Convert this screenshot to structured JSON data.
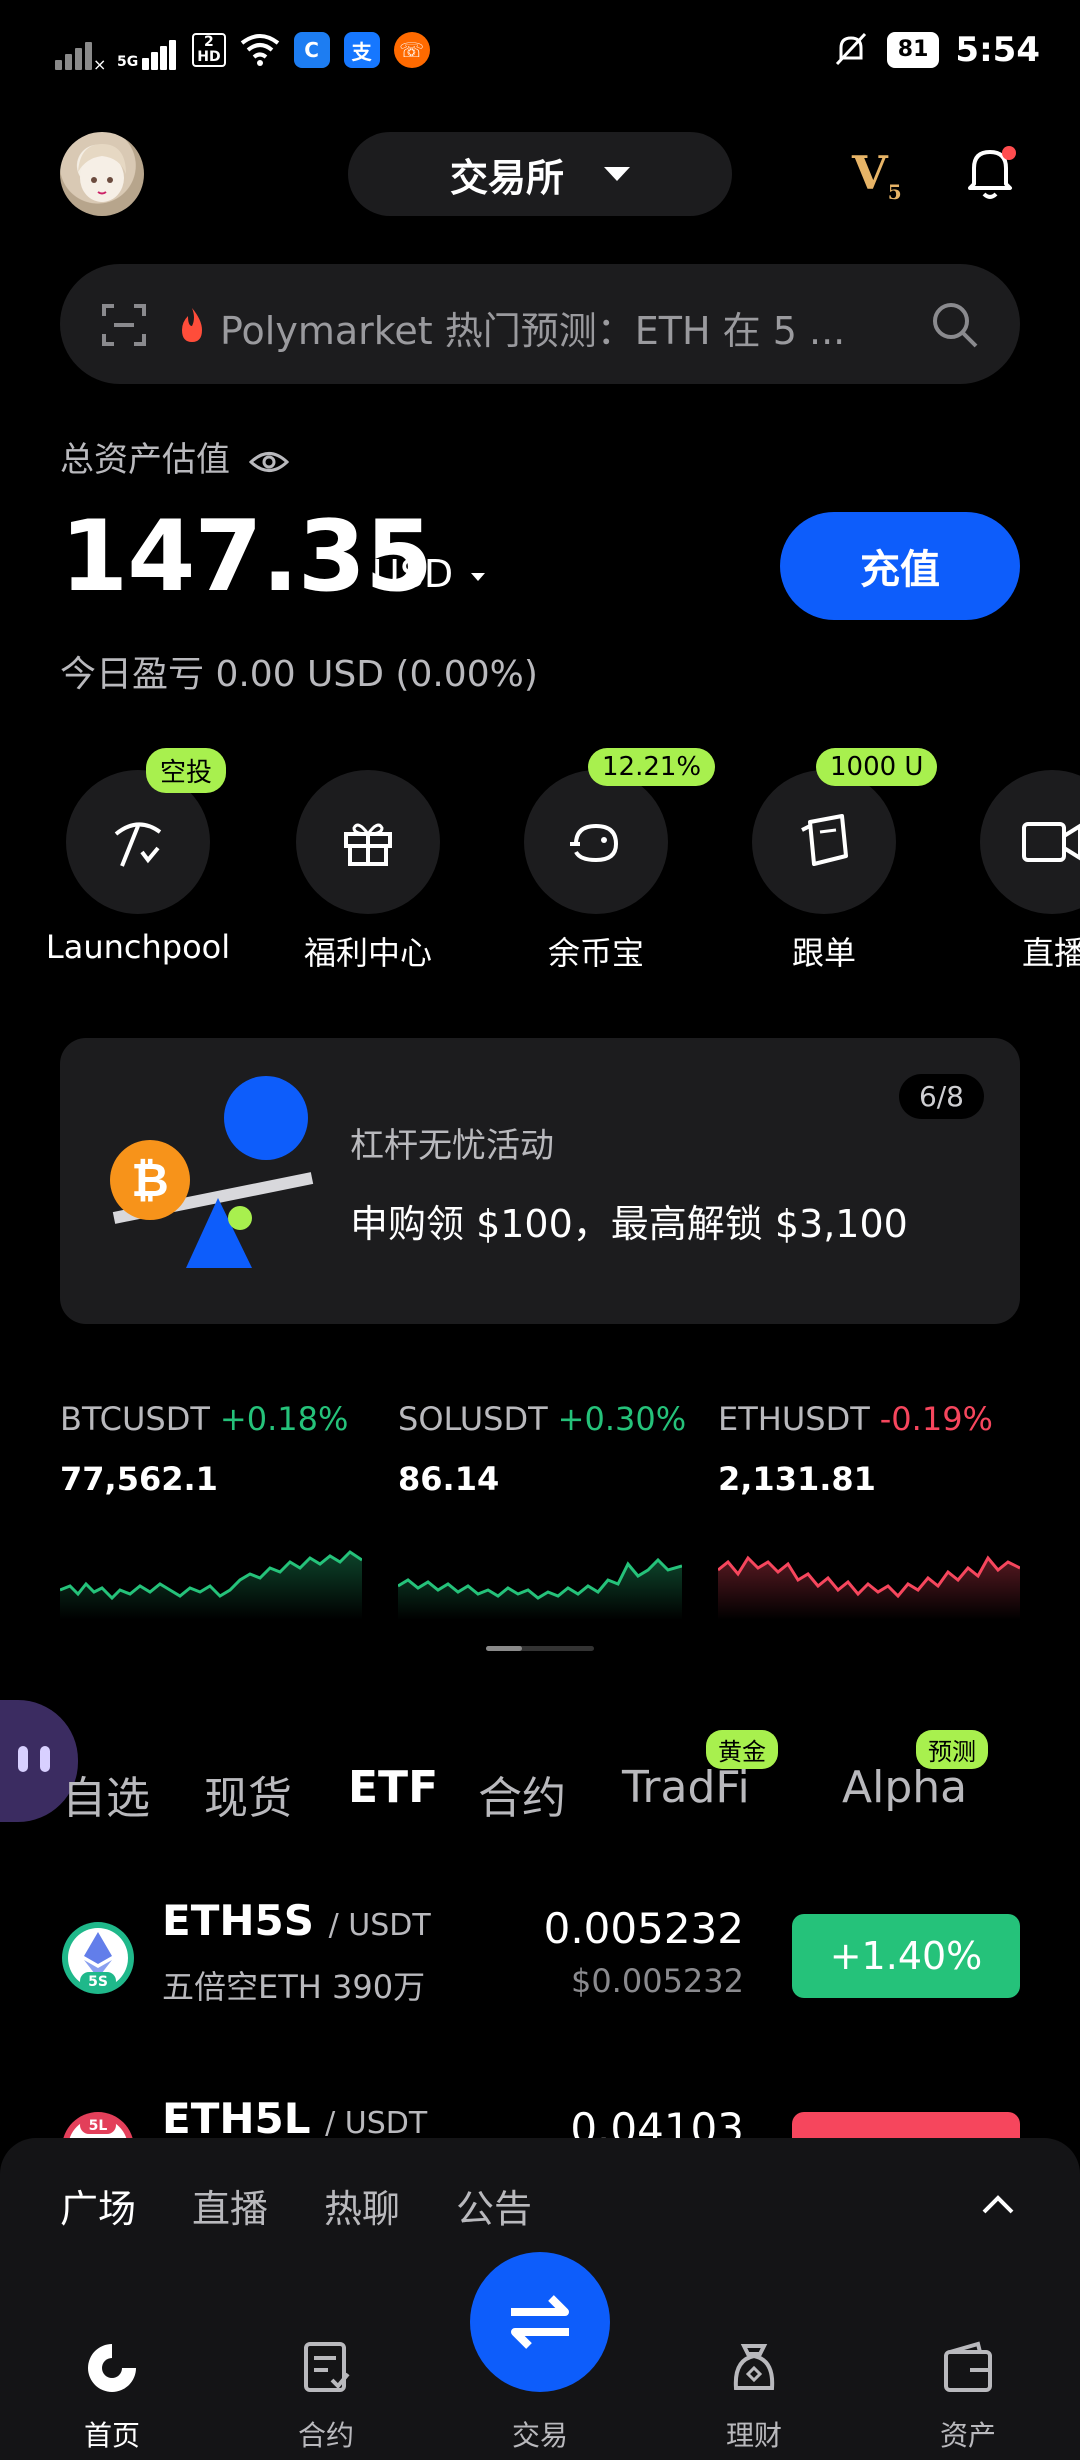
{
  "status_bar": {
    "network_5g": "5G",
    "hd_label": "2\nHD",
    "wifi_label": "6",
    "battery": "81",
    "time": "5:54"
  },
  "header": {
    "exchange_label": "交易所",
    "vip_label": "V",
    "vip_level": "5"
  },
  "search": {
    "placeholder": "Polymarket 热门预测：ETH 在 5 ..."
  },
  "assets": {
    "label": "总资产估值",
    "total": "147.35",
    "currency": "USD",
    "recharge_label": "充值",
    "pnl": "今日盈亏 0.00 USD (0.00%)"
  },
  "shortcuts": [
    {
      "name": "Launchpool",
      "badge": "空投"
    },
    {
      "name": "福利中心",
      "badge": ""
    },
    {
      "name": "余币宝",
      "badge": "12.21%"
    },
    {
      "name": "跟单",
      "badge": "1000 U"
    },
    {
      "name": "直播",
      "badge": ""
    }
  ],
  "banner": {
    "counter": "6/8",
    "subtitle": "杠杆无忧活动",
    "title": "申购领 $100，最高解锁 $3,100"
  },
  "tickers": [
    {
      "symbol": "BTCUSDT",
      "change": "+0.18%",
      "price": "77,562.1",
      "direction": "up"
    },
    {
      "symbol": "SOLUSDT",
      "change": "+0.30%",
      "price": "86.14",
      "direction": "up"
    },
    {
      "symbol": "ETHUSDT",
      "change": "-0.19%",
      "price": "2,131.81",
      "direction": "down"
    }
  ],
  "market_tabs": [
    {
      "label": "自选",
      "badge": ""
    },
    {
      "label": "现货",
      "badge": ""
    },
    {
      "label": "ETF",
      "badge": "",
      "active": true
    },
    {
      "label": "合约",
      "badge": ""
    },
    {
      "label": "TradFi",
      "badge": "黄金"
    },
    {
      "label": "Alpha",
      "badge": "预测"
    }
  ],
  "rows": [
    {
      "symbol": "ETH5S",
      "quote": "/ USDT",
      "desc": "五倍空ETH 390万",
      "price": "0.005232",
      "price_usd": "$0.005232",
      "change": "+1.40%",
      "icon_label": "5S",
      "direction": "up"
    },
    {
      "symbol": "ETH5L",
      "quote": "/ USDT",
      "desc": "",
      "price": "0.04103",
      "price_usd": "",
      "change": "",
      "icon_label": "5L",
      "direction": "down"
    }
  ],
  "bottom_panel": {
    "tabs": [
      "广场",
      "直播",
      "热聊",
      "公告"
    ]
  },
  "nav": [
    {
      "label": "首页",
      "icon": "home-icon"
    },
    {
      "label": "合约",
      "icon": "contract-icon"
    },
    {
      "label": "交易",
      "icon": "trade-icon"
    },
    {
      "label": "理财",
      "icon": "finance-icon"
    },
    {
      "label": "资产",
      "icon": "wallet-icon"
    }
  ],
  "colors": {
    "accent": "#0d5dfb",
    "up": "#25c27a",
    "down": "#f6465d",
    "badge": "#a8f04e",
    "surface": "#1c1c1e"
  }
}
